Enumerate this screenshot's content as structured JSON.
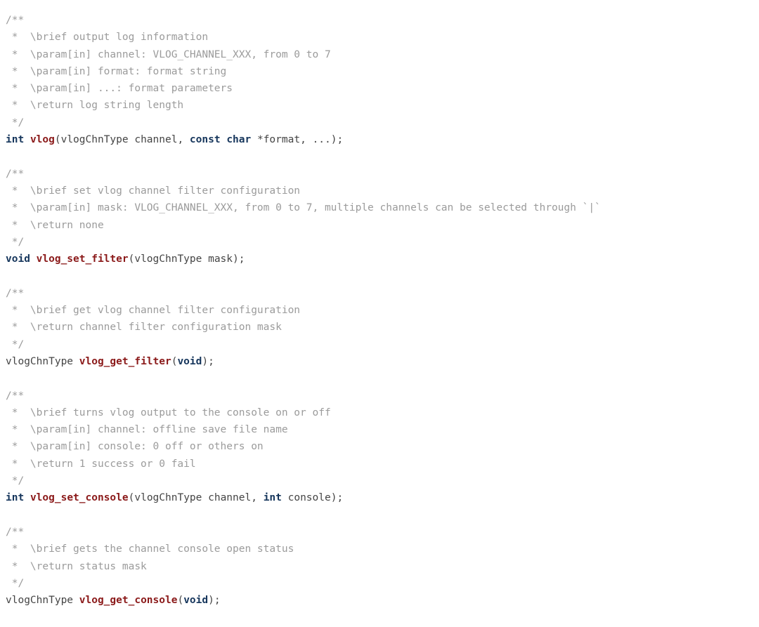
{
  "document": {
    "kind": "c-header-source",
    "language": "C",
    "background_color": "#ffffff",
    "colors": {
      "comment": "#9b9b9b",
      "keyword": "#16365c",
      "function_name": "#8b1a1a",
      "plain": "#444444"
    }
  },
  "blocks": [
    {
      "id": "vlog",
      "comment": [
        "/**",
        " *  \\brief output log information",
        " *  \\param[in] channel: VLOG_CHANNEL_XXX, from 0 to 7",
        " *  \\param[in] format: format string",
        " *  \\param[in] ...: format parameters",
        " *  \\return log string length",
        " */"
      ],
      "declaration": {
        "text": "int vlog(vlogChnType channel, const char *format, ...);",
        "tokens": [
          {
            "t": "int",
            "k": "keyword"
          },
          {
            "t": " ",
            "k": "plain"
          },
          {
            "t": "vlog",
            "k": "funcname"
          },
          {
            "t": "(vlogChnType channel, ",
            "k": "plain"
          },
          {
            "t": "const",
            "k": "keyword"
          },
          {
            "t": " ",
            "k": "plain"
          },
          {
            "t": "char",
            "k": "keyword"
          },
          {
            "t": " *format, ...);",
            "k": "plain"
          }
        ]
      }
    },
    {
      "id": "vlog_set_filter",
      "comment": [
        "/**",
        " *  \\brief set vlog channel filter configuration",
        " *  \\param[in] mask: VLOG_CHANNEL_XXX, from 0 to 7, multiple channels can be selected through `|`",
        " *  \\return none",
        " */"
      ],
      "declaration": {
        "text": "void vlog_set_filter(vlogChnType mask);",
        "tokens": [
          {
            "t": "void",
            "k": "keyword"
          },
          {
            "t": " ",
            "k": "plain"
          },
          {
            "t": "vlog_set_filter",
            "k": "funcname"
          },
          {
            "t": "(vlogChnType mask);",
            "k": "plain"
          }
        ]
      }
    },
    {
      "id": "vlog_get_filter",
      "comment": [
        "/**",
        " *  \\brief get vlog channel filter configuration",
        " *  \\return channel filter configuration mask",
        " */"
      ],
      "declaration": {
        "text": "vlogChnType vlog_get_filter(void);",
        "tokens": [
          {
            "t": "vlogChnType ",
            "k": "plain"
          },
          {
            "t": "vlog_get_filter",
            "k": "funcname"
          },
          {
            "t": "(",
            "k": "plain"
          },
          {
            "t": "void",
            "k": "keyword"
          },
          {
            "t": ");",
            "k": "plain"
          }
        ]
      }
    },
    {
      "id": "vlog_set_console",
      "comment": [
        "/**",
        " *  \\brief turns vlog output to the console on or off",
        " *  \\param[in] channel: offline save file name",
        " *  \\param[in] console: 0 off or others on",
        " *  \\return 1 success or 0 fail",
        " */"
      ],
      "declaration": {
        "text": "int vlog_set_console(vlogChnType channel, int console);",
        "tokens": [
          {
            "t": "int",
            "k": "keyword"
          },
          {
            "t": " ",
            "k": "plain"
          },
          {
            "t": "vlog_set_console",
            "k": "funcname"
          },
          {
            "t": "(vlogChnType channel, ",
            "k": "plain"
          },
          {
            "t": "int",
            "k": "keyword"
          },
          {
            "t": " console);",
            "k": "plain"
          }
        ]
      }
    },
    {
      "id": "vlog_get_console",
      "comment": [
        "/**",
        " *  \\brief gets the channel console open status",
        " *  \\return status mask",
        " */"
      ],
      "declaration": {
        "text": "vlogChnType vlog_get_console(void);",
        "tokens": [
          {
            "t": "vlogChnType ",
            "k": "plain"
          },
          {
            "t": "vlog_get_console",
            "k": "funcname"
          },
          {
            "t": "(",
            "k": "plain"
          },
          {
            "t": "void",
            "k": "keyword"
          },
          {
            "t": ");",
            "k": "plain"
          }
        ]
      }
    }
  ]
}
